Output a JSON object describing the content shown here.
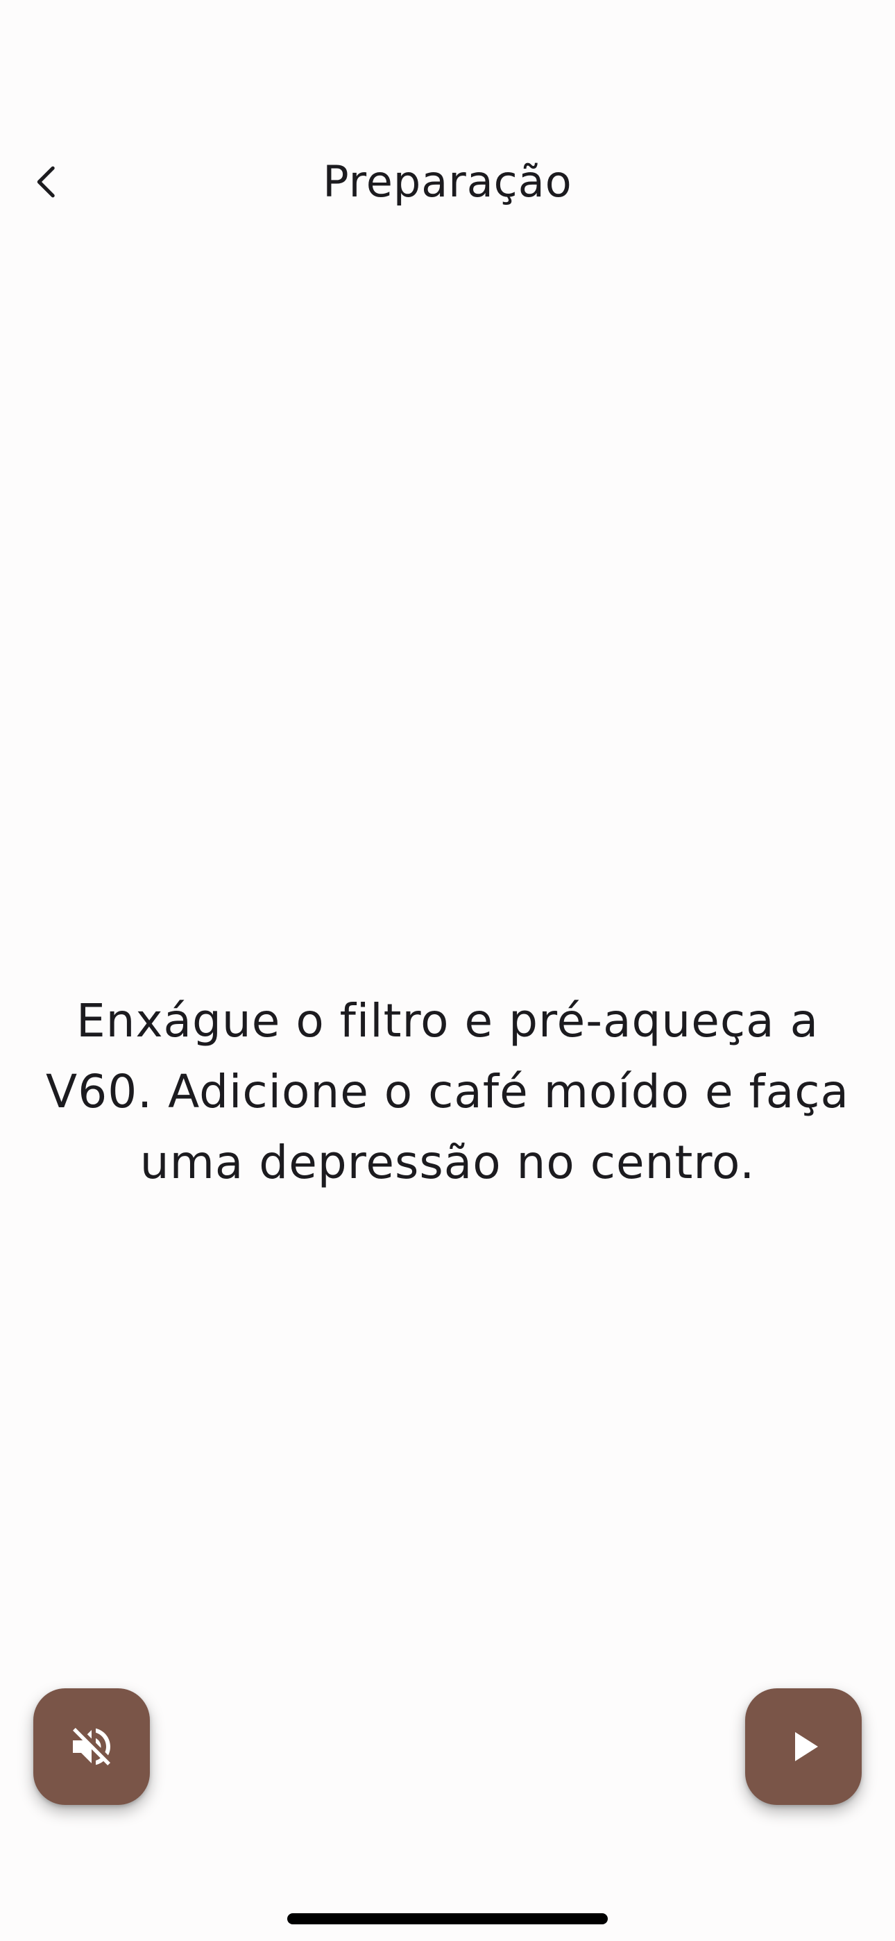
{
  "header": {
    "title": "Preparação",
    "back_icon": "chevron-left-icon"
  },
  "step": {
    "instruction": "Enxágue o filtro e pré-aqueça a V60. Adicione o café moído e faça uma depressão no centro."
  },
  "controls": {
    "mute_icon": "volume-off-icon",
    "play_icon": "play-icon",
    "button_color": "#7a5548",
    "icon_color": "#ffffff"
  }
}
